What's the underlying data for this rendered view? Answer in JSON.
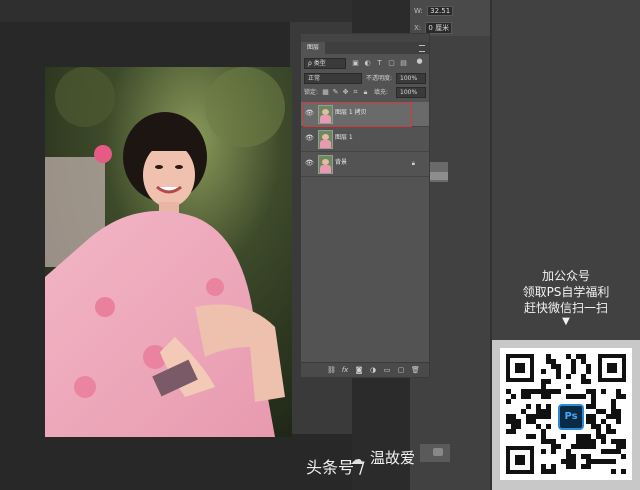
{
  "properties": {
    "w_label": "W:",
    "w_value": "32.51",
    "x_label": "X:",
    "x_value": "0 厘米"
  },
  "layers_panel": {
    "tab_label": "图层",
    "filter_kind": "ρ 类型",
    "blend_mode": "正常",
    "opacity_label": "不透明度:",
    "opacity_value": "100%",
    "lock_label": "锁定:",
    "fill_label": "填充:",
    "fill_value": "100%",
    "layers": [
      {
        "name": "图层 1 拷贝",
        "selected": true
      },
      {
        "name": "图层 1",
        "selected": false
      },
      {
        "name": "背景",
        "selected": false,
        "locked": true
      }
    ],
    "bottom_icons": [
      "link-icon",
      "fx-icon",
      "mask-icon",
      "adjustment-icon",
      "group-icon",
      "new-layer-icon",
      "trash-icon"
    ],
    "fx_label": "fx"
  },
  "promo": {
    "line1": "加公众号",
    "line2": "领取PS自学福利",
    "line3": "赶快微信扫一扫",
    "arrow": "▼"
  },
  "qr": {
    "logo_text": "Ps"
  },
  "watermark": {
    "prefix": "头条号 /",
    "name": "温故爱",
    "icon": "wechat-icon"
  },
  "colors": {
    "selection_outline": "#d23a3a",
    "ps_blue": "#2c8bd8"
  }
}
